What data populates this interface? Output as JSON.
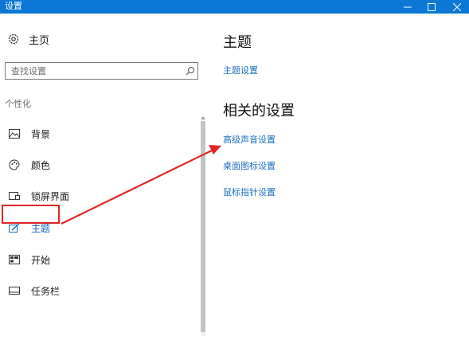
{
  "window": {
    "title": "设置",
    "minimize_glyph": "—",
    "maximize_glyph": "☐",
    "close_glyph": "✕"
  },
  "sidebar": {
    "home_label": "主页",
    "search": {
      "placeholder": "查找设置",
      "value": ""
    },
    "section_label": "个性化",
    "items": [
      {
        "label": "背景",
        "icon": "picture-icon"
      },
      {
        "label": "颜色",
        "icon": "palette-icon"
      },
      {
        "label": "锁屏界面",
        "icon": "lock-screen-icon"
      },
      {
        "label": "主题",
        "icon": "theme-icon",
        "selected": true
      },
      {
        "label": "开始",
        "icon": "start-icon"
      },
      {
        "label": "任务栏",
        "icon": "taskbar-icon"
      }
    ]
  },
  "main": {
    "title": "主题",
    "theme_settings_link": "主题设置",
    "related_title": "相关的设置",
    "related_links": [
      "高级声音设置",
      "桌面图标设置",
      "鼠标指针设置"
    ]
  },
  "colors": {
    "titlebar": "#0a78d4",
    "link": "#1a6fbf",
    "selected": "#1464c8",
    "annotation": "#e02424"
  }
}
